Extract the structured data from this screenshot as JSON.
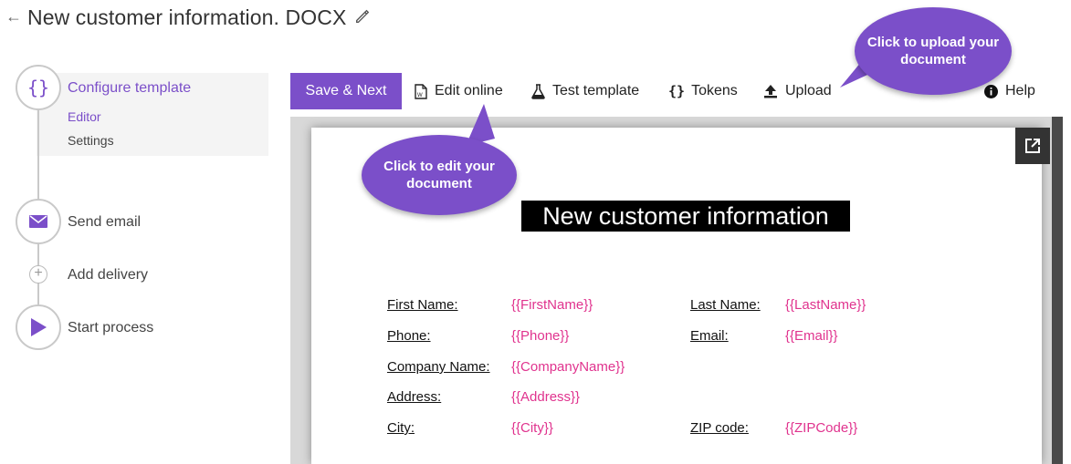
{
  "header": {
    "back_icon": "back-arrow-icon",
    "title": "New customer information. DOCX",
    "edit_icon": "pencil-icon"
  },
  "steps": {
    "configure": {
      "label": "Configure template",
      "icon": "braces-icon"
    },
    "subitems": [
      "Editor",
      "Settings"
    ],
    "send_email": {
      "label": "Send email",
      "icon": "envelope-icon"
    },
    "add_delivery": {
      "label": "Add delivery",
      "icon": "plus-icon"
    },
    "start_process": {
      "label": "Start process",
      "icon": "play-icon"
    }
  },
  "toolbar": {
    "save_next": "Save & Next",
    "edit_online": "Edit online",
    "test_template": "Test template",
    "tokens": "Tokens",
    "upload": "Upload",
    "help": "Help"
  },
  "callouts": {
    "upload": "Click to upload your document",
    "edit": "Click to edit your document"
  },
  "document": {
    "title": "New customer information",
    "fields": [
      {
        "label": "First Name:",
        "token": "{{FirstName}}"
      },
      {
        "label": "Last Name:",
        "token": "{{LastName}}"
      },
      {
        "label": "Phone:",
        "token": "{{Phone}}"
      },
      {
        "label": "Email:",
        "token": "{{Email}}"
      },
      {
        "label": "Company Name:",
        "token": "{{CompanyName}}"
      },
      {
        "label": "Address:",
        "token": "{{Address}}"
      },
      {
        "label": "City:",
        "token": "{{City}}"
      },
      {
        "label": "ZIP code:",
        "token": "{{ZIPCode}}"
      }
    ]
  },
  "colors": {
    "accent": "#7b4fc9",
    "token": "#e0338e"
  }
}
